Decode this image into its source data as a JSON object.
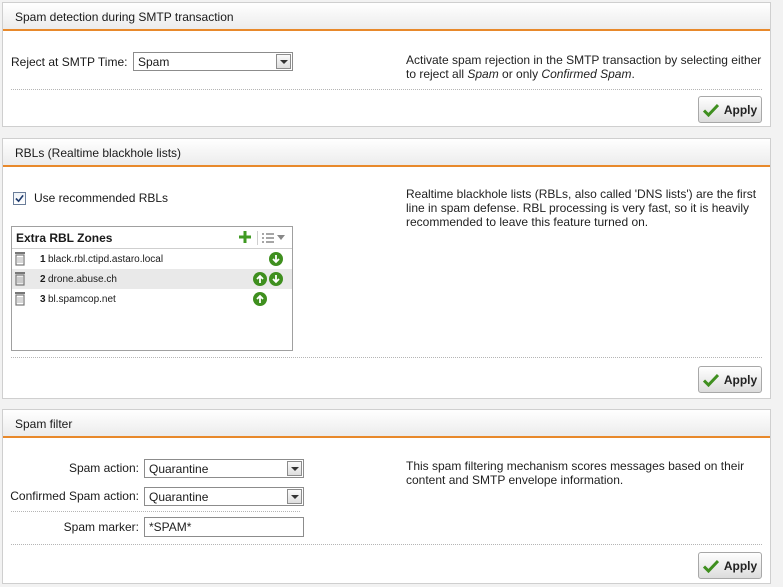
{
  "smtp": {
    "title": "Spam detection during SMTP transaction",
    "reject_label": "Reject at SMTP Time:",
    "reject_value": "Spam",
    "desc_1": "Activate spam rejection in the SMTP transaction by selecting either",
    "desc_2a": "to reject all ",
    "desc_2b": "Spam",
    "desc_2c": " or only ",
    "desc_2d": "Confirmed Spam",
    "desc_2e": ".",
    "apply": "Apply"
  },
  "rbl": {
    "title": "RBLs (Realtime blackhole lists)",
    "use_recommended_label": "Use recommended RBLs",
    "use_recommended_checked": true,
    "desc_1": "Realtime blackhole lists (RBLs, also called 'DNS lists') are the first",
    "desc_2": "line in spam defense. RBL processing is very fast, so it is heavily",
    "desc_3": "recommended to leave this feature turned on.",
    "zones_title": "Extra RBL Zones",
    "zones": [
      {
        "num": "1",
        "zone": "black.rbl.ctipd.astaro.local"
      },
      {
        "num": "2",
        "zone": "drone.abuse.ch"
      },
      {
        "num": "3",
        "zone": "bl.spamcop.net"
      }
    ],
    "apply": "Apply"
  },
  "filter": {
    "title": "Spam filter",
    "spam_action_label": "Spam action:",
    "spam_action_value": "Quarantine",
    "confirmed_label": "Confirmed Spam action:",
    "confirmed_value": "Quarantine",
    "marker_label": "Spam marker:",
    "marker_value": "*SPAM*",
    "desc_1": "This spam filtering mechanism scores messages based on their",
    "desc_2": "content and SMTP envelope information.",
    "apply": "Apply"
  },
  "colors": {
    "accent": "#e8892b",
    "green": "#3f8f1f"
  },
  "icons": [
    "check-icon",
    "checkbox-check-icon",
    "add-icon",
    "list-icon",
    "trash-icon",
    "arrow-up-icon",
    "arrow-down-icon"
  ]
}
